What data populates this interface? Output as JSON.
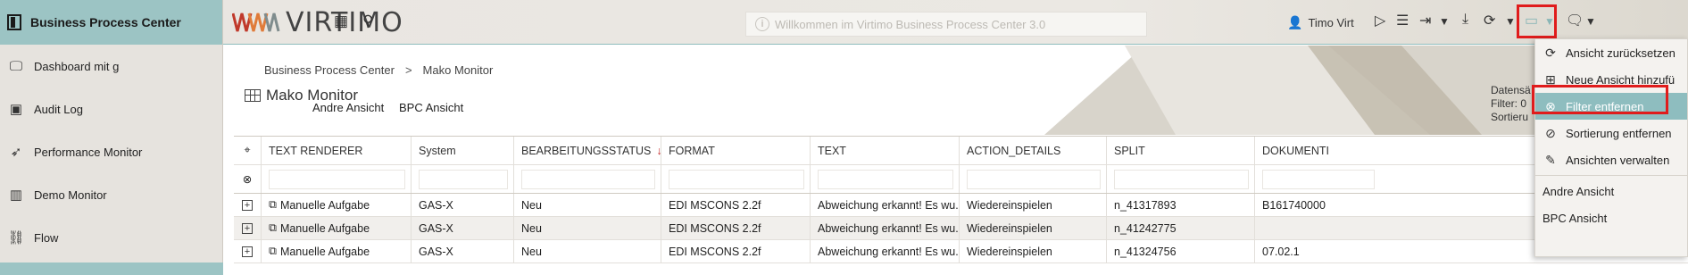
{
  "sidebar": {
    "header": "Business Process Center",
    "items": [
      {
        "label": "Dashboard mit g",
        "icon": "monitor-icon"
      },
      {
        "label": "Audit Log",
        "icon": "calendar-check-icon"
      },
      {
        "label": "Performance Monitor",
        "icon": "rocket-icon"
      },
      {
        "label": "Demo Monitor",
        "icon": "barcode-icon"
      },
      {
        "label": "Flow",
        "icon": "flow-icon"
      }
    ]
  },
  "topbar": {
    "brand": "VIRTIMO",
    "welcome": "Willkommen im Virtimo Business Process Center 3.0",
    "user": "Timo Virt"
  },
  "main": {
    "breadcrumb": [
      "Business Process Center",
      "Mako Monitor"
    ],
    "title": "Mako Monitor",
    "views": [
      "Andre Ansicht",
      "BPC Ansicht"
    ],
    "side_info": [
      "Datensä",
      "Filter: 0",
      "Sortieru"
    ]
  },
  "table": {
    "columns": [
      "TEXT RENDERER",
      "System",
      "BEARBEITUNGSSTATUS",
      "FORMAT",
      "TEXT",
      "ACTION_DETAILS",
      "SPLIT",
      "DOKUMENTI"
    ],
    "sort_indicator": "↓1",
    "rows": [
      [
        "Manuelle Aufgabe",
        "GAS-X",
        "Neu",
        "EDI MSCONS 2.2f",
        "Abweichung erkannt! Es wu...",
        "Wiedereinspielen",
        "n_41317893",
        "B161740000"
      ],
      [
        "Manuelle Aufgabe",
        "GAS-X",
        "Neu",
        "EDI MSCONS 2.2f",
        "Abweichung erkannt! Es wu...",
        "Wiedereinspielen",
        "n_41242775",
        ""
      ],
      [
        "Manuelle Aufgabe",
        "GAS-X",
        "Neu",
        "EDI MSCONS 2.2f",
        "Abweichung erkannt! Es wu...",
        "Wiedereinspielen",
        "n_41324756",
        "07.02.1"
      ]
    ]
  },
  "dropdown": {
    "items": [
      {
        "label": "Ansicht zurücksetzen",
        "icon": "refresh-icon"
      },
      {
        "label": "Neue Ansicht hinzufü",
        "icon": "plus-square-icon"
      },
      {
        "label": "Filter entfernen",
        "icon": "circle-x-icon",
        "active": true
      },
      {
        "label": "Sortierung entfernen",
        "icon": "no-sort-icon"
      },
      {
        "label": "Ansichten verwalten",
        "icon": "pencil-icon"
      }
    ],
    "views": [
      "Andre Ansicht",
      "BPC Ansicht"
    ]
  },
  "colors": {
    "accent": "#9cc4c4",
    "highlight": "#e01c1c",
    "active_item": "#8ebdbf"
  }
}
